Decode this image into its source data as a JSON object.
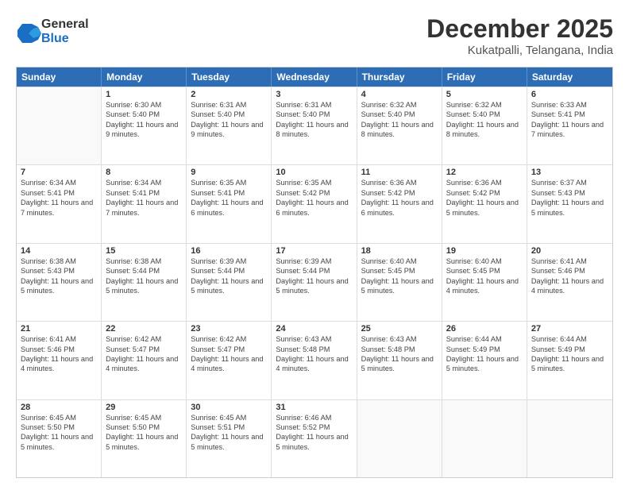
{
  "logo": {
    "general": "General",
    "blue": "Blue"
  },
  "title": "December 2025",
  "subtitle": "Kukatpalli, Telangana, India",
  "header_days": [
    "Sunday",
    "Monday",
    "Tuesday",
    "Wednesday",
    "Thursday",
    "Friday",
    "Saturday"
  ],
  "weeks": [
    [
      {
        "day": "",
        "sunrise": "",
        "sunset": "",
        "daylight": ""
      },
      {
        "day": "1",
        "sunrise": "Sunrise: 6:30 AM",
        "sunset": "Sunset: 5:40 PM",
        "daylight": "Daylight: 11 hours and 9 minutes."
      },
      {
        "day": "2",
        "sunrise": "Sunrise: 6:31 AM",
        "sunset": "Sunset: 5:40 PM",
        "daylight": "Daylight: 11 hours and 9 minutes."
      },
      {
        "day": "3",
        "sunrise": "Sunrise: 6:31 AM",
        "sunset": "Sunset: 5:40 PM",
        "daylight": "Daylight: 11 hours and 8 minutes."
      },
      {
        "day": "4",
        "sunrise": "Sunrise: 6:32 AM",
        "sunset": "Sunset: 5:40 PM",
        "daylight": "Daylight: 11 hours and 8 minutes."
      },
      {
        "day": "5",
        "sunrise": "Sunrise: 6:32 AM",
        "sunset": "Sunset: 5:40 PM",
        "daylight": "Daylight: 11 hours and 8 minutes."
      },
      {
        "day": "6",
        "sunrise": "Sunrise: 6:33 AM",
        "sunset": "Sunset: 5:41 PM",
        "daylight": "Daylight: 11 hours and 7 minutes."
      }
    ],
    [
      {
        "day": "7",
        "sunrise": "Sunrise: 6:34 AM",
        "sunset": "Sunset: 5:41 PM",
        "daylight": "Daylight: 11 hours and 7 minutes."
      },
      {
        "day": "8",
        "sunrise": "Sunrise: 6:34 AM",
        "sunset": "Sunset: 5:41 PM",
        "daylight": "Daylight: 11 hours and 7 minutes."
      },
      {
        "day": "9",
        "sunrise": "Sunrise: 6:35 AM",
        "sunset": "Sunset: 5:41 PM",
        "daylight": "Daylight: 11 hours and 6 minutes."
      },
      {
        "day": "10",
        "sunrise": "Sunrise: 6:35 AM",
        "sunset": "Sunset: 5:42 PM",
        "daylight": "Daylight: 11 hours and 6 minutes."
      },
      {
        "day": "11",
        "sunrise": "Sunrise: 6:36 AM",
        "sunset": "Sunset: 5:42 PM",
        "daylight": "Daylight: 11 hours and 6 minutes."
      },
      {
        "day": "12",
        "sunrise": "Sunrise: 6:36 AM",
        "sunset": "Sunset: 5:42 PM",
        "daylight": "Daylight: 11 hours and 5 minutes."
      },
      {
        "day": "13",
        "sunrise": "Sunrise: 6:37 AM",
        "sunset": "Sunset: 5:43 PM",
        "daylight": "Daylight: 11 hours and 5 minutes."
      }
    ],
    [
      {
        "day": "14",
        "sunrise": "Sunrise: 6:38 AM",
        "sunset": "Sunset: 5:43 PM",
        "daylight": "Daylight: 11 hours and 5 minutes."
      },
      {
        "day": "15",
        "sunrise": "Sunrise: 6:38 AM",
        "sunset": "Sunset: 5:44 PM",
        "daylight": "Daylight: 11 hours and 5 minutes."
      },
      {
        "day": "16",
        "sunrise": "Sunrise: 6:39 AM",
        "sunset": "Sunset: 5:44 PM",
        "daylight": "Daylight: 11 hours and 5 minutes."
      },
      {
        "day": "17",
        "sunrise": "Sunrise: 6:39 AM",
        "sunset": "Sunset: 5:44 PM",
        "daylight": "Daylight: 11 hours and 5 minutes."
      },
      {
        "day": "18",
        "sunrise": "Sunrise: 6:40 AM",
        "sunset": "Sunset: 5:45 PM",
        "daylight": "Daylight: 11 hours and 5 minutes."
      },
      {
        "day": "19",
        "sunrise": "Sunrise: 6:40 AM",
        "sunset": "Sunset: 5:45 PM",
        "daylight": "Daylight: 11 hours and 4 minutes."
      },
      {
        "day": "20",
        "sunrise": "Sunrise: 6:41 AM",
        "sunset": "Sunset: 5:46 PM",
        "daylight": "Daylight: 11 hours and 4 minutes."
      }
    ],
    [
      {
        "day": "21",
        "sunrise": "Sunrise: 6:41 AM",
        "sunset": "Sunset: 5:46 PM",
        "daylight": "Daylight: 11 hours and 4 minutes."
      },
      {
        "day": "22",
        "sunrise": "Sunrise: 6:42 AM",
        "sunset": "Sunset: 5:47 PM",
        "daylight": "Daylight: 11 hours and 4 minutes."
      },
      {
        "day": "23",
        "sunrise": "Sunrise: 6:42 AM",
        "sunset": "Sunset: 5:47 PM",
        "daylight": "Daylight: 11 hours and 4 minutes."
      },
      {
        "day": "24",
        "sunrise": "Sunrise: 6:43 AM",
        "sunset": "Sunset: 5:48 PM",
        "daylight": "Daylight: 11 hours and 4 minutes."
      },
      {
        "day": "25",
        "sunrise": "Sunrise: 6:43 AM",
        "sunset": "Sunset: 5:48 PM",
        "daylight": "Daylight: 11 hours and 5 minutes."
      },
      {
        "day": "26",
        "sunrise": "Sunrise: 6:44 AM",
        "sunset": "Sunset: 5:49 PM",
        "daylight": "Daylight: 11 hours and 5 minutes."
      },
      {
        "day": "27",
        "sunrise": "Sunrise: 6:44 AM",
        "sunset": "Sunset: 5:49 PM",
        "daylight": "Daylight: 11 hours and 5 minutes."
      }
    ],
    [
      {
        "day": "28",
        "sunrise": "Sunrise: 6:45 AM",
        "sunset": "Sunset: 5:50 PM",
        "daylight": "Daylight: 11 hours and 5 minutes."
      },
      {
        "day": "29",
        "sunrise": "Sunrise: 6:45 AM",
        "sunset": "Sunset: 5:50 PM",
        "daylight": "Daylight: 11 hours and 5 minutes."
      },
      {
        "day": "30",
        "sunrise": "Sunrise: 6:45 AM",
        "sunset": "Sunset: 5:51 PM",
        "daylight": "Daylight: 11 hours and 5 minutes."
      },
      {
        "day": "31",
        "sunrise": "Sunrise: 6:46 AM",
        "sunset": "Sunset: 5:52 PM",
        "daylight": "Daylight: 11 hours and 5 minutes."
      },
      {
        "day": "",
        "sunrise": "",
        "sunset": "",
        "daylight": ""
      },
      {
        "day": "",
        "sunrise": "",
        "sunset": "",
        "daylight": ""
      },
      {
        "day": "",
        "sunrise": "",
        "sunset": "",
        "daylight": ""
      }
    ]
  ]
}
